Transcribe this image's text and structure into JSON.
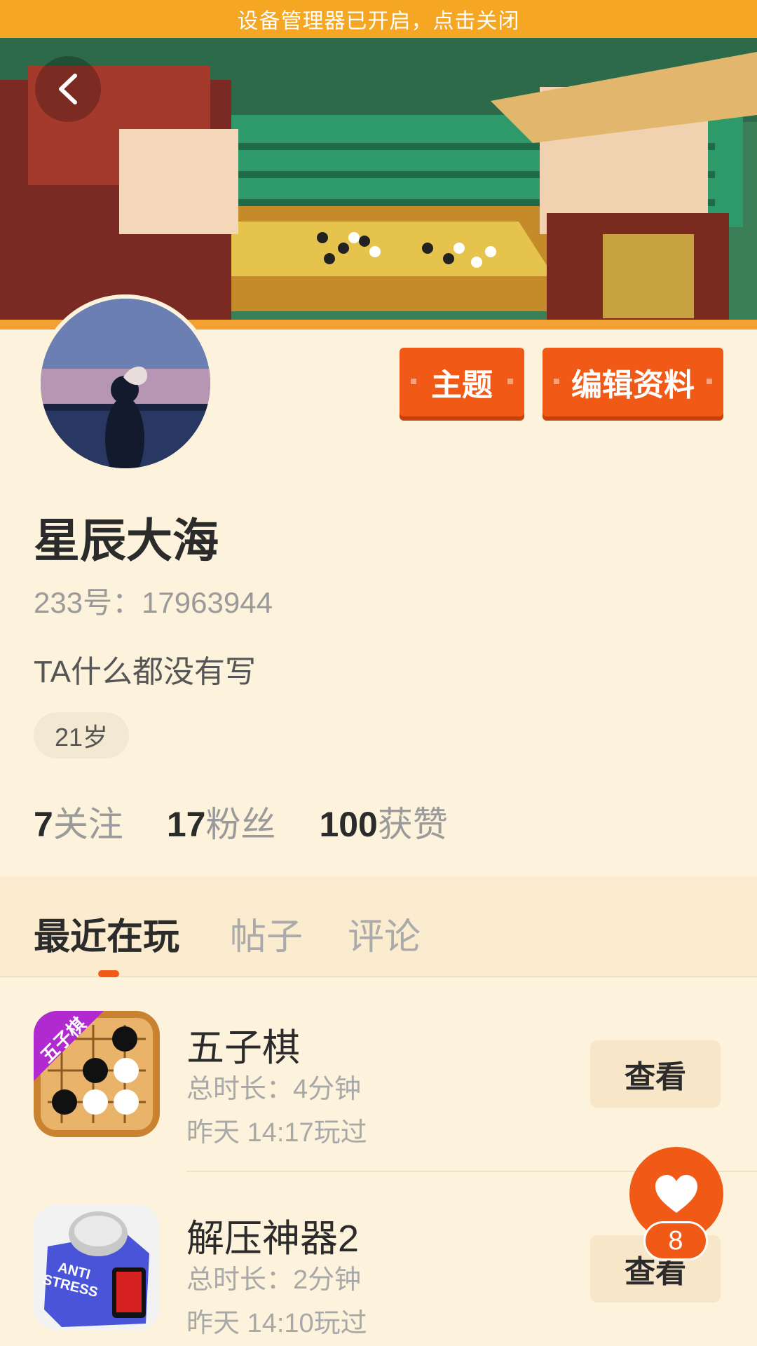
{
  "banner": {
    "text": "设备管理器已开启，点击关闭"
  },
  "profile": {
    "theme_button": "主题",
    "edit_button": "编辑资料",
    "nickname": "星辰大海",
    "uid": "233号：17963944",
    "bio": "TA什么都没有写",
    "age": "21岁"
  },
  "stats": [
    {
      "number": "7",
      "label": "关注"
    },
    {
      "number": "17",
      "label": "粉丝"
    },
    {
      "number": "100",
      "label": "获赞"
    }
  ],
  "tabs": [
    {
      "label": "最近在玩",
      "active": true
    },
    {
      "label": "帖子",
      "active": false
    },
    {
      "label": "评论",
      "active": false
    }
  ],
  "games": [
    {
      "title": "五子棋",
      "duration": "总时长：4分钟",
      "last_played": "昨天 14:17玩过",
      "button": "查看",
      "icon_badge": "五子棋"
    },
    {
      "title": "解压神器2",
      "duration": "总时长：2分钟",
      "last_played": "昨天 14:10玩过",
      "button": "查看",
      "icon_text": "ANTI STRESS"
    }
  ],
  "like": {
    "count": "8"
  },
  "colors": {
    "accent": "#f05a16",
    "banner": "#f5a623",
    "background": "#fdf3dc"
  }
}
